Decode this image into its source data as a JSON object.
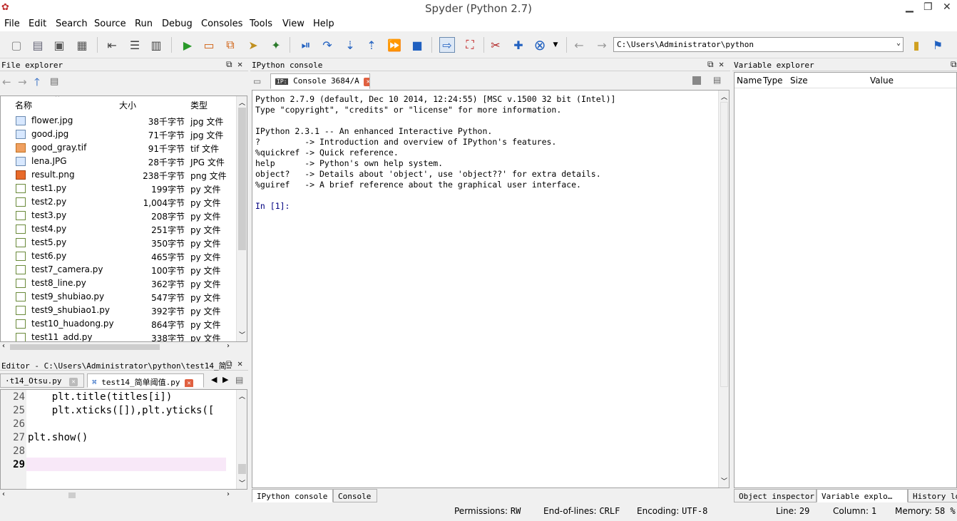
{
  "window": {
    "title": "Spyder (Python 2.7)"
  },
  "menu": [
    "File",
    "Edit",
    "Search",
    "Source",
    "Run",
    "Debug",
    "Consoles",
    "Tools",
    "View",
    "Help"
  ],
  "toolbar": {
    "path": "C:\\Users\\Administrator\\python"
  },
  "file_explorer": {
    "title": "File explorer",
    "columns": [
      "名称",
      "大小",
      "类型"
    ],
    "files": [
      {
        "name": "flower.jpg",
        "size": "38千字节",
        "type": "jpg 文件",
        "kind": "img"
      },
      {
        "name": "good.jpg",
        "size": "71千字节",
        "type": "jpg 文件",
        "kind": "img"
      },
      {
        "name": "good_gray.tif",
        "size": "91千字节",
        "type": "tif 文件",
        "kind": "tif"
      },
      {
        "name": "lena.JPG",
        "size": "28千字节",
        "type": "JPG 文件",
        "kind": "img"
      },
      {
        "name": "result.png",
        "size": "238千字节",
        "type": "png 文件",
        "kind": "png"
      },
      {
        "name": "test1.py",
        "size": "199字节",
        "type": "py 文件",
        "kind": "py"
      },
      {
        "name": "test2.py",
        "size": "1,004字节",
        "type": "py 文件",
        "kind": "py"
      },
      {
        "name": "test3.py",
        "size": "208字节",
        "type": "py 文件",
        "kind": "py"
      },
      {
        "name": "test4.py",
        "size": "251字节",
        "type": "py 文件",
        "kind": "py"
      },
      {
        "name": "test5.py",
        "size": "350字节",
        "type": "py 文件",
        "kind": "py"
      },
      {
        "name": "test6.py",
        "size": "465字节",
        "type": "py 文件",
        "kind": "py"
      },
      {
        "name": "test7_camera.py",
        "size": "100字节",
        "type": "py 文件",
        "kind": "py"
      },
      {
        "name": "test8_line.py",
        "size": "362字节",
        "type": "py 文件",
        "kind": "py"
      },
      {
        "name": "test9_shubiao.py",
        "size": "547字节",
        "type": "py 文件",
        "kind": "py"
      },
      {
        "name": "test9_shubiao1.py",
        "size": "392字节",
        "type": "py 文件",
        "kind": "py"
      },
      {
        "name": "test10_huadong.py",
        "size": "864字节",
        "type": "py 文件",
        "kind": "py"
      },
      {
        "name": "test11_add.py",
        "size": "338字节",
        "type": "py 文件",
        "kind": "py"
      }
    ]
  },
  "editor": {
    "title": "Editor - C:\\Users\\Administrator\\python\\test14_简…",
    "tabs": [
      "·t14_Otsu.py",
      "test14_简单阈值.py"
    ],
    "lines": [
      {
        "n": "24",
        "code": "    plt.title(titles[i])"
      },
      {
        "n": "25",
        "code": "    plt.xticks([]),plt.yticks(["
      },
      {
        "n": "26",
        "code": ""
      },
      {
        "n": "27",
        "code": "plt.show()"
      },
      {
        "n": "28",
        "code": ""
      },
      {
        "n": "29",
        "code": ""
      }
    ]
  },
  "ipython": {
    "title": "IPython console",
    "tab": "Console 3684/A",
    "lines": [
      "Python 2.7.9 (default, Dec 10 2014, 12:24:55) [MSC v.1500 32 bit (Intel)]",
      "Type \"copyright\", \"credits\" or \"license\" for more information.",
      "",
      "IPython 2.3.1 -- An enhanced Interactive Python.",
      "?         -> Introduction and overview of IPython's features.",
      "%quickref -> Quick reference.",
      "help      -> Python's own help system.",
      "object?   -> Details about 'object', use 'object??' for extra details.",
      "%guiref   -> A brief reference about the graphical user interface.",
      "",
      "In [1]:"
    ],
    "bottom_tabs": [
      "IPython console",
      "Console"
    ]
  },
  "variable_explorer": {
    "title": "Variable explorer",
    "columns": [
      "Name",
      "Type",
      "Size",
      "Value"
    ],
    "bottom_tabs": [
      "Object inspector",
      "Variable explo…",
      "History lo"
    ]
  },
  "status": {
    "permissions_label": "Permissions:",
    "permissions": "RW",
    "eol_label": "End-of-lines:",
    "eol": "CRLF",
    "encoding_label": "Encoding:",
    "encoding": "UTF-8",
    "line_label": "Line:",
    "line": "29",
    "column_label": "Column:",
    "column": "1",
    "memory_label": "Memory:",
    "memory": "58 %"
  }
}
